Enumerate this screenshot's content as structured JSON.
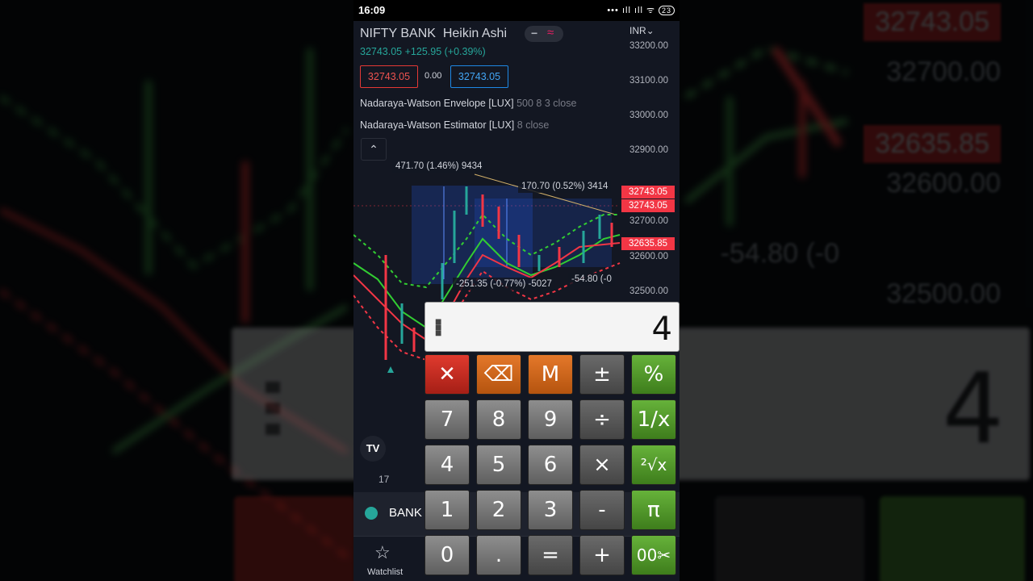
{
  "status_bar": {
    "time": "16:09",
    "icons": "••• ıll ıll ᯤ",
    "battery": "23"
  },
  "chart": {
    "symbol": "NIFTY BANK",
    "chart_style": "Heikin Ashi",
    "quote": "32743.05 +125.95 (+0.39%)",
    "bid": "32743.05",
    "spread": "0.00",
    "ask": "32743.05",
    "currency": "INR",
    "indicators": [
      {
        "name": "Nadaraya-Watson Envelope [LUX]",
        "params": "500 8 3 close"
      },
      {
        "name": "Nadaraya-Watson Estimator [LUX]",
        "params": "8 close"
      }
    ],
    "y_ticks": [
      "33200.00",
      "33100.00",
      "33000.00",
      "32900.00",
      "32700.00",
      "32600.00",
      "32500.00"
    ],
    "price_tags": [
      "32743.05",
      "32743.05",
      "32635.85"
    ],
    "measure_labels": [
      "471.70 (1.46%) 9434",
      "170.70 (0.52%) 3414",
      "-251.35 (-0.77%) -5027",
      "-54.80 (-0"
    ],
    "date_label": "17",
    "logo_text": "TV"
  },
  "watch_strip": {
    "symbol": "BANK"
  },
  "bottom_nav": {
    "watchlist_label": "Watchlist"
  },
  "calculator": {
    "display": "4",
    "keys": {
      "clear": "✕",
      "backspace": "⌫",
      "memory": "M",
      "sign": "±",
      "percent": "%",
      "seven": "7",
      "eight": "8",
      "nine": "9",
      "divide": "÷",
      "reciprocal": "1/x",
      "four": "4",
      "five": "5",
      "six": "6",
      "multiply": "×",
      "root": "²√x",
      "one": "1",
      "two": "2",
      "three": "3",
      "minus": "-",
      "pi": "π",
      "zero": "0",
      "dot": ".",
      "equals": "=",
      "plus": "+",
      "cut": "00✂"
    }
  },
  "background": {
    "prices": [
      "32743.05",
      "32700.00",
      "32635.85",
      "32600.00",
      "-54.80 (-0",
      "32500.00"
    ],
    "calc_display": "4"
  },
  "colors": {
    "up": "#26a69a",
    "down": "#f23645",
    "accent_blue": "#2962ff",
    "chart_bg": "#131722"
  }
}
